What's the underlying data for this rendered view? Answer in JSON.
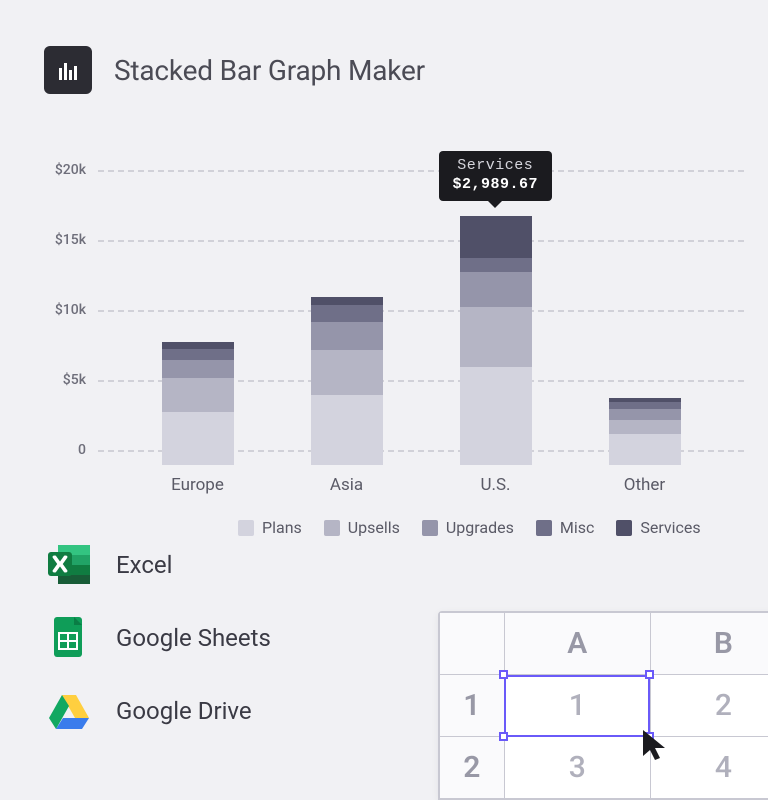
{
  "header": {
    "title": "Stacked Bar Graph Maker"
  },
  "chart_data": {
    "type": "bar",
    "stacked": true,
    "categories": [
      "Europe",
      "Asia",
      "U.S.",
      "Other"
    ],
    "series": [
      {
        "name": "Plans",
        "values": [
          3800,
          5000,
          7000,
          2200
        ]
      },
      {
        "name": "Upsells",
        "values": [
          2400,
          3200,
          4300,
          1000
        ]
      },
      {
        "name": "Upgrades",
        "values": [
          1300,
          2000,
          2500,
          800
        ]
      },
      {
        "name": "Misc",
        "values": [
          800,
          1200,
          1000,
          500
        ]
      },
      {
        "name": "Services",
        "values": [
          500,
          600,
          2989.67,
          300
        ]
      }
    ],
    "xlabel": "",
    "ylabel": "",
    "y_ticks": [
      "0",
      "$5k",
      "$10k",
      "$15k",
      "$20k"
    ],
    "ylim": [
      0,
      20000
    ],
    "legend_position": "bottom",
    "tooltip": {
      "series": "Services",
      "value_display": "$2,989.67",
      "category": "U.S."
    }
  },
  "legend_colors": [
    "#d3d3de",
    "#b5b5c5",
    "#9595aa",
    "#6f6f88",
    "#505068"
  ],
  "sources": [
    {
      "label": "Excel"
    },
    {
      "label": "Google Sheets"
    },
    {
      "label": "Google Drive"
    }
  ],
  "sheet": {
    "columns": [
      "A",
      "B"
    ],
    "rows": [
      {
        "num": "1",
        "cells": [
          "1",
          "2"
        ]
      },
      {
        "num": "2",
        "cells": [
          "3",
          "4"
        ]
      }
    ],
    "selected_cell": {
      "row": 0,
      "col": 0
    }
  }
}
